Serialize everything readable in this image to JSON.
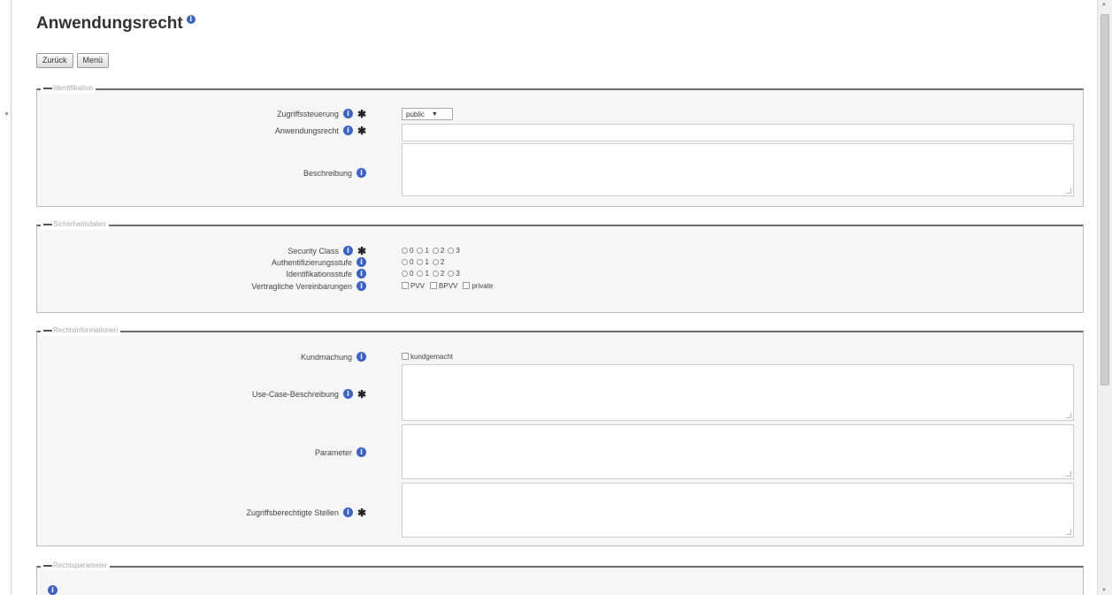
{
  "page_title": "Anwendungsrecht",
  "buttons": {
    "back": "Zurück",
    "menu": "Menü"
  },
  "sections": {
    "identifikation": {
      "legend": "Identifikation",
      "zugriff_label": "Zugriffssteuerung",
      "zugriff_value": "public",
      "anwendungsrecht_label": "Anwendungsrecht",
      "beschreibung_label": "Beschreibung"
    },
    "sicherheit": {
      "legend": "Sicherheitsdaten",
      "security_label": "Security Class",
      "security_options": [
        "0",
        "1",
        "2",
        "3"
      ],
      "auth_label": "Authentifizierungsstufe",
      "auth_options": [
        "0",
        "1",
        "2"
      ],
      "ident_label": "Identifikationsstufe",
      "ident_options": [
        "0",
        "1",
        "2",
        "3"
      ],
      "vertrag_label": "Vertragliche Vereinbarungen",
      "vertrag_options": [
        "PVV",
        "BPVV",
        "private"
      ]
    },
    "recht": {
      "legend": "Rechtsinformationen",
      "kundmachung_label": "Kundmachung",
      "kundmachung_option": "kundgemacht",
      "usecase_label": "Use-Case-Beschreibung",
      "parameter_label": "Parameter",
      "stellen_label": "Zugriffsberechtigte Stellen"
    },
    "rechtsparameter": {
      "legend": "Rechtsparameter"
    }
  },
  "colors": {
    "info_icon": "#3b62c6",
    "section_bg": "#f6f6f6"
  }
}
